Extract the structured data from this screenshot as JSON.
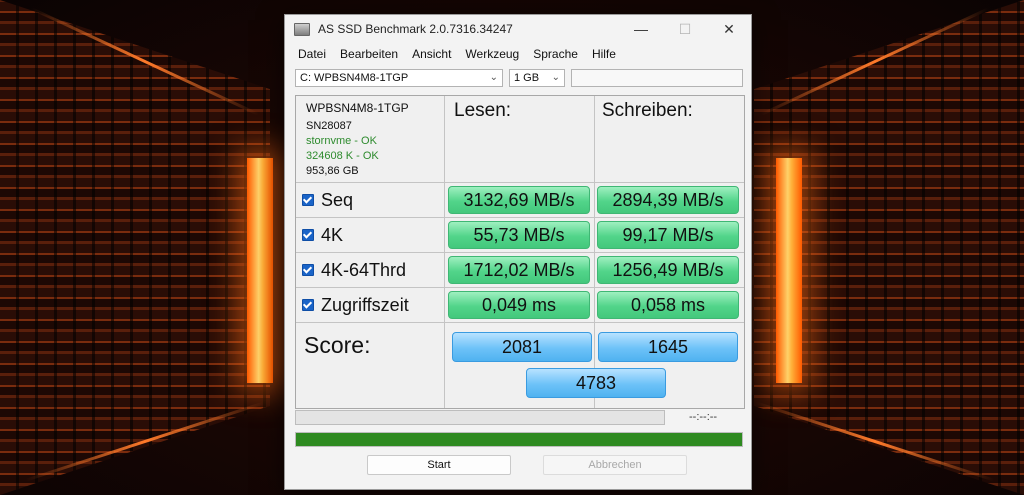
{
  "window": {
    "title": "AS SSD Benchmark 2.0.7316.34247",
    "controls": {
      "minimize": "—",
      "maximize": "☐",
      "close": "✕"
    }
  },
  "menu": [
    "Datei",
    "Bearbeiten",
    "Ansicht",
    "Werkzeug",
    "Sprache",
    "Hilfe"
  ],
  "toolbar": {
    "drive": "C: WPBSN4M8-1TGP",
    "size": "1 GB"
  },
  "drive_info": {
    "model": "WPBSN4M8-1TGP",
    "firmware": "SN28087",
    "driver": "stornvme - OK",
    "alignment": "324608 K - OK",
    "capacity": "953,86 GB"
  },
  "headers": {
    "read": "Lesen:",
    "write": "Schreiben:"
  },
  "rows": [
    {
      "label": "Seq",
      "checked": true,
      "read": "3132,69 MB/s",
      "write": "2894,39 MB/s"
    },
    {
      "label": "4K",
      "checked": true,
      "read": "55,73 MB/s",
      "write": "99,17 MB/s"
    },
    {
      "label": "4K-64Thrd",
      "checked": true,
      "read": "1712,02 MB/s",
      "write": "1256,49 MB/s"
    },
    {
      "label": "Zugriffszeit",
      "checked": true,
      "read": "0,049 ms",
      "write": "0,058 ms"
    }
  ],
  "score": {
    "label": "Score:",
    "read": "2081",
    "write": "1645",
    "total": "4783"
  },
  "progress": {
    "timer": "--:--:--",
    "overall_fraction": 1.0
  },
  "buttons": {
    "start": "Start",
    "cancel": "Abbrechen"
  },
  "colors": {
    "value_green": "#52d48a",
    "score_blue": "#6dc2f8",
    "progress_green": "#2e8a20",
    "ok_text": "#2e8b2e"
  }
}
